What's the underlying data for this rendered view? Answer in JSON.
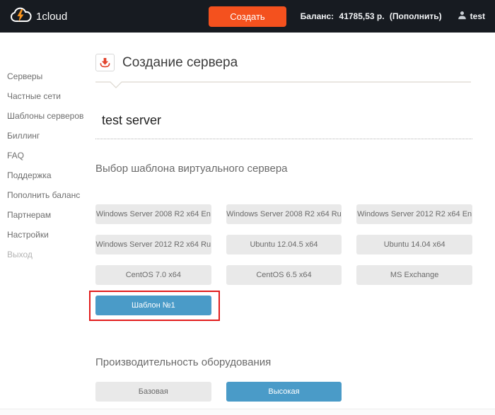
{
  "header": {
    "logo_text": "1cloud",
    "create_button_label": "Создать",
    "balance_label": "Баланс:",
    "balance_value": "41785,53 р.",
    "topup_link_label": "(Пополнить)",
    "username": "test"
  },
  "sidebar": {
    "items": [
      "Серверы",
      "Частные сети",
      "Шаблоны серверов",
      "Биллинг",
      "FAQ",
      "Поддержка",
      "Пополнить баланс",
      "Партнерам",
      "Настройки",
      "Выход"
    ]
  },
  "main": {
    "page_title": "Создание сервера",
    "server_name_value": "test server",
    "template_section_title": "Выбор шаблона виртуального сервера",
    "templates": [
      "Windows Server 2008 R2 x64 En",
      "Windows Server 2008 R2 x64 Ru",
      "Windows Server 2012 R2 x64 En",
      "Windows Server 2012 R2 x64 Ru",
      "Ubuntu 12.04.5 x64",
      "Ubuntu 14.04 x64",
      "CentOS 7.0 x64",
      "CentOS 6.5 x64",
      "MS Exchange"
    ],
    "selected_template": "Шаблон №1",
    "performance_section_title": "Производительность оборудования",
    "performance_options": [
      {
        "label": "Базовая",
        "selected": false
      },
      {
        "label": "Высокая",
        "selected": true
      }
    ]
  },
  "icons": {
    "logo": "cloud-with-lightning-bolt",
    "page_title": "download-arrow-into-tray",
    "user": "person-silhouette"
  },
  "colors": {
    "header_background": "#171b21",
    "accent_orange": "#f4511e",
    "accent_blue": "#4a9bc8",
    "annotation_red": "#e11c1c",
    "button_gray": "#e9e9e9"
  }
}
